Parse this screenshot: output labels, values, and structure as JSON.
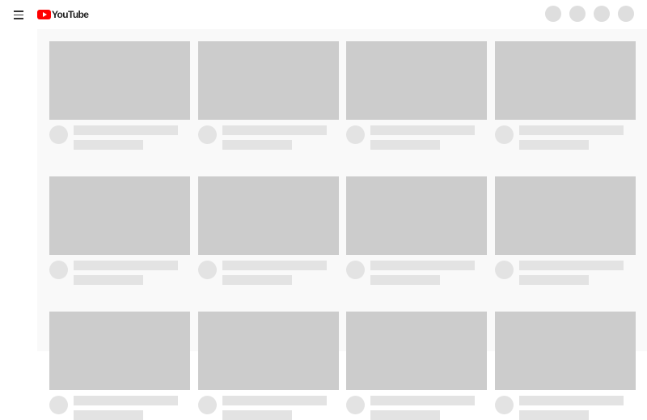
{
  "masthead": {
    "logo_text": "YouTube",
    "menu_icon": "hamburger-menu-icon",
    "logo_icon": "youtube-play-icon",
    "placeholder_buttons": 4,
    "logo_color": "#ff0000"
  },
  "skeleton": {
    "rows": 3,
    "columns": 4,
    "thumbnail_color": "#cccccc",
    "meta_color": "#e3e3e3",
    "background_color": "#f9f9f9"
  }
}
